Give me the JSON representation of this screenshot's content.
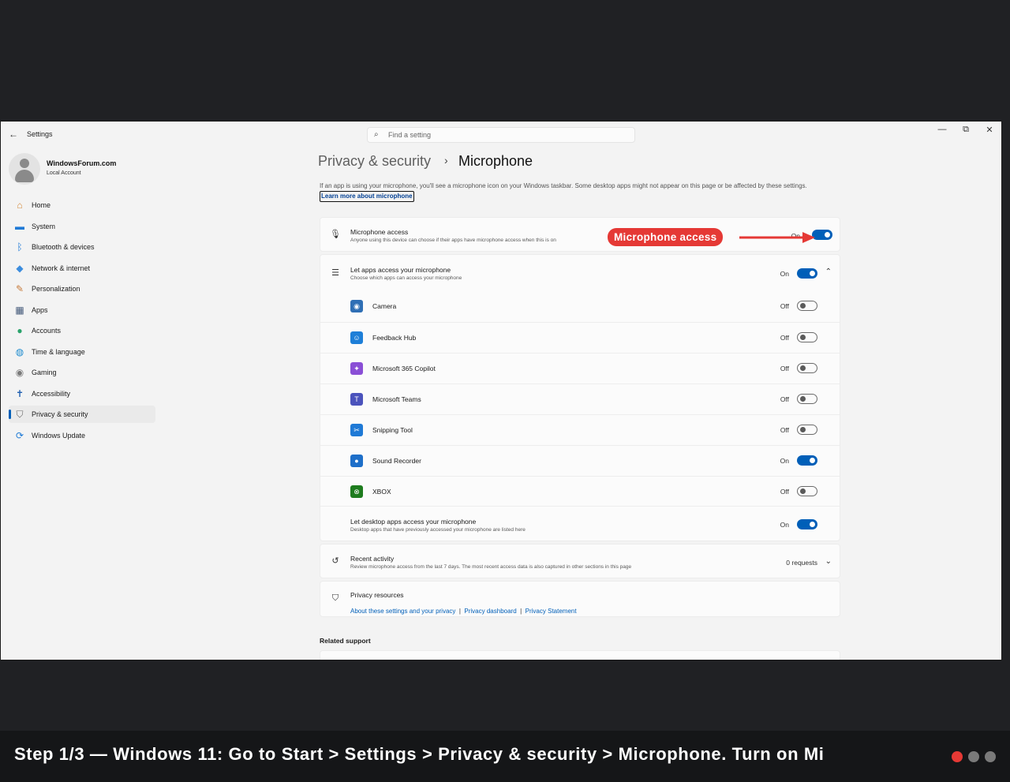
{
  "window": {
    "app_title": "Settings",
    "search_placeholder": "Find a setting",
    "controls": [
      "—",
      "⧉",
      "✕"
    ]
  },
  "profile": {
    "name": "WindowsForum.com",
    "account_type": "Local Account"
  },
  "sidebar": {
    "items": [
      {
        "label": "Home",
        "icon": "home-icon",
        "glyph": "⌂",
        "color": "#d4883a"
      },
      {
        "label": "System",
        "icon": "system-icon",
        "glyph": "▬",
        "color": "#1f7ad6"
      },
      {
        "label": "Bluetooth & devices",
        "icon": "bluetooth-icon",
        "glyph": "ᛒ",
        "color": "#1f7ad6"
      },
      {
        "label": "Network & internet",
        "icon": "network-icon",
        "glyph": "◆",
        "color": "#3c8dde"
      },
      {
        "label": "Personalization",
        "icon": "brush-icon",
        "glyph": "✎",
        "color": "#c77a3a"
      },
      {
        "label": "Apps",
        "icon": "apps-icon",
        "glyph": "▦",
        "color": "#445a7a"
      },
      {
        "label": "Accounts",
        "icon": "accounts-icon",
        "glyph": "●",
        "color": "#2aa36b"
      },
      {
        "label": "Time & language",
        "icon": "globe-icon",
        "glyph": "◍",
        "color": "#1f8ccf"
      },
      {
        "label": "Gaming",
        "icon": "gamepad-icon",
        "glyph": "◉",
        "color": "#7a7a7a"
      },
      {
        "label": "Accessibility",
        "icon": "accessibility-icon",
        "glyph": "✝",
        "color": "#1f5fb0"
      },
      {
        "label": "Privacy & security",
        "icon": "shield-icon",
        "glyph": "⛉",
        "color": "#6a6a6a"
      },
      {
        "label": "Windows Update",
        "icon": "update-icon",
        "glyph": "⟳",
        "color": "#1f7ad6"
      }
    ],
    "active_index": 10
  },
  "breadcrumb": {
    "parent": "Privacy & security",
    "separator": "›",
    "current": "Microphone"
  },
  "intro": {
    "text": "If an app is using your microphone, you'll see a microphone icon on your Windows taskbar. Some desktop apps might not appear on this page or be affected by these settings.",
    "link": "Learn more about microphone"
  },
  "microphone_access": {
    "title": "Microphone access",
    "description": "Anyone using this device can choose if their apps have microphone access when this is on",
    "state": "On",
    "on": true
  },
  "annotation": {
    "label": "Microphone access",
    "color": "#e53935"
  },
  "let_apps": {
    "title": "Let apps access your microphone",
    "description": "Choose which apps can access your microphone",
    "state": "On",
    "on": true
  },
  "apps": [
    {
      "name": "Camera",
      "state": "Off",
      "on": false,
      "icon": "camera-icon",
      "glyph": "◉",
      "color": "#2f6fb5"
    },
    {
      "name": "Feedback Hub",
      "state": "Off",
      "on": false,
      "icon": "feedback-hub-icon",
      "glyph": "☺",
      "color": "#1e7fd8"
    },
    {
      "name": "Microsoft 365 Copilot",
      "state": "Off",
      "on": false,
      "icon": "copilot-icon",
      "glyph": "✦",
      "color": "#8a4fd6"
    },
    {
      "name": "Microsoft Teams",
      "state": "Off",
      "on": false,
      "icon": "teams-icon",
      "glyph": "T",
      "color": "#4b53bc"
    },
    {
      "name": "Snipping Tool",
      "state": "Off",
      "on": false,
      "icon": "snipping-tool-icon",
      "glyph": "✂",
      "color": "#1f7ad6"
    },
    {
      "name": "Sound Recorder",
      "state": "On",
      "on": true,
      "icon": "sound-recorder-icon",
      "glyph": "●",
      "color": "#1e6fc9"
    },
    {
      "name": "XBOX",
      "state": "Off",
      "on": false,
      "icon": "xbox-icon",
      "glyph": "⊗",
      "color": "#1e7c1e"
    }
  ],
  "desktop_apps": {
    "title": "Let desktop apps access your microphone",
    "description": "Desktop apps that have previously accessed your microphone are listed here",
    "state": "On",
    "on": true
  },
  "recent_activity": {
    "title": "Recent activity",
    "description": "Review microphone access from the last 7 days. The most recent access data is also captured in other sections in this page",
    "value": "0 requests"
  },
  "privacy_resources": {
    "title": "Privacy resources",
    "links": [
      "About these settings and your privacy",
      "Privacy dashboard",
      "Privacy Statement"
    ],
    "separator": "|"
  },
  "related_support": "Related support",
  "caption": {
    "text": "Step 1/3 — Windows 11: Go to Start > Settings > Privacy & security > Microphone. Turn on Mi",
    "dots": [
      "#e53935",
      "#7a7a7a",
      "#7a7a7a"
    ]
  }
}
